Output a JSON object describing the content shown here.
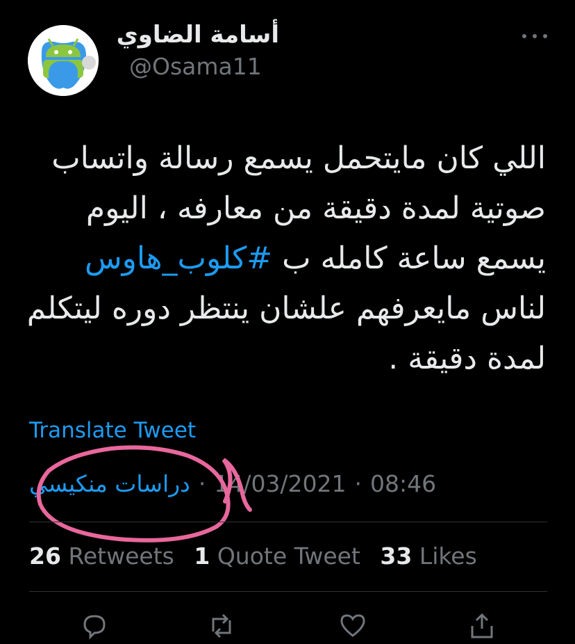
{
  "user": {
    "display_name": "أسامة الضاوي",
    "handle": "@Osama11",
    "avatar_icon": "android-apple-avatar-icon"
  },
  "tweet": {
    "lines": [
      "اللي كان مايتحمل يسمع رسالة واتساب",
      "صوتية لمدة دقيقة من معارفه ، اليوم",
      "يسمع ساعة كامله ب"
    ],
    "hashtag": "#كلوب_هاوس",
    "lines_after": [
      "لناس مايعرفهم علشان ينتظر دوره ليتكلم",
      "لمدة دقيقة ."
    ]
  },
  "translate_label": "Translate Tweet",
  "meta": {
    "source": "دراسات منكيسي",
    "separator": "·",
    "date": "14/03/2021",
    "time": "08:46"
  },
  "stats": {
    "retweets_count": "26",
    "retweets_label": "Retweets",
    "quotes_count": "1",
    "quotes_label": "Quote Tweet",
    "likes_count": "33",
    "likes_label": "Likes"
  },
  "colors": {
    "background": "#000000",
    "text": "#e7e9ea",
    "secondary": "#71767b",
    "link": "#1d9bf0",
    "annotation": "#e8679c"
  },
  "icons": [
    "more-icon",
    "reply-icon",
    "retweet-icon",
    "like-icon",
    "share-icon"
  ]
}
